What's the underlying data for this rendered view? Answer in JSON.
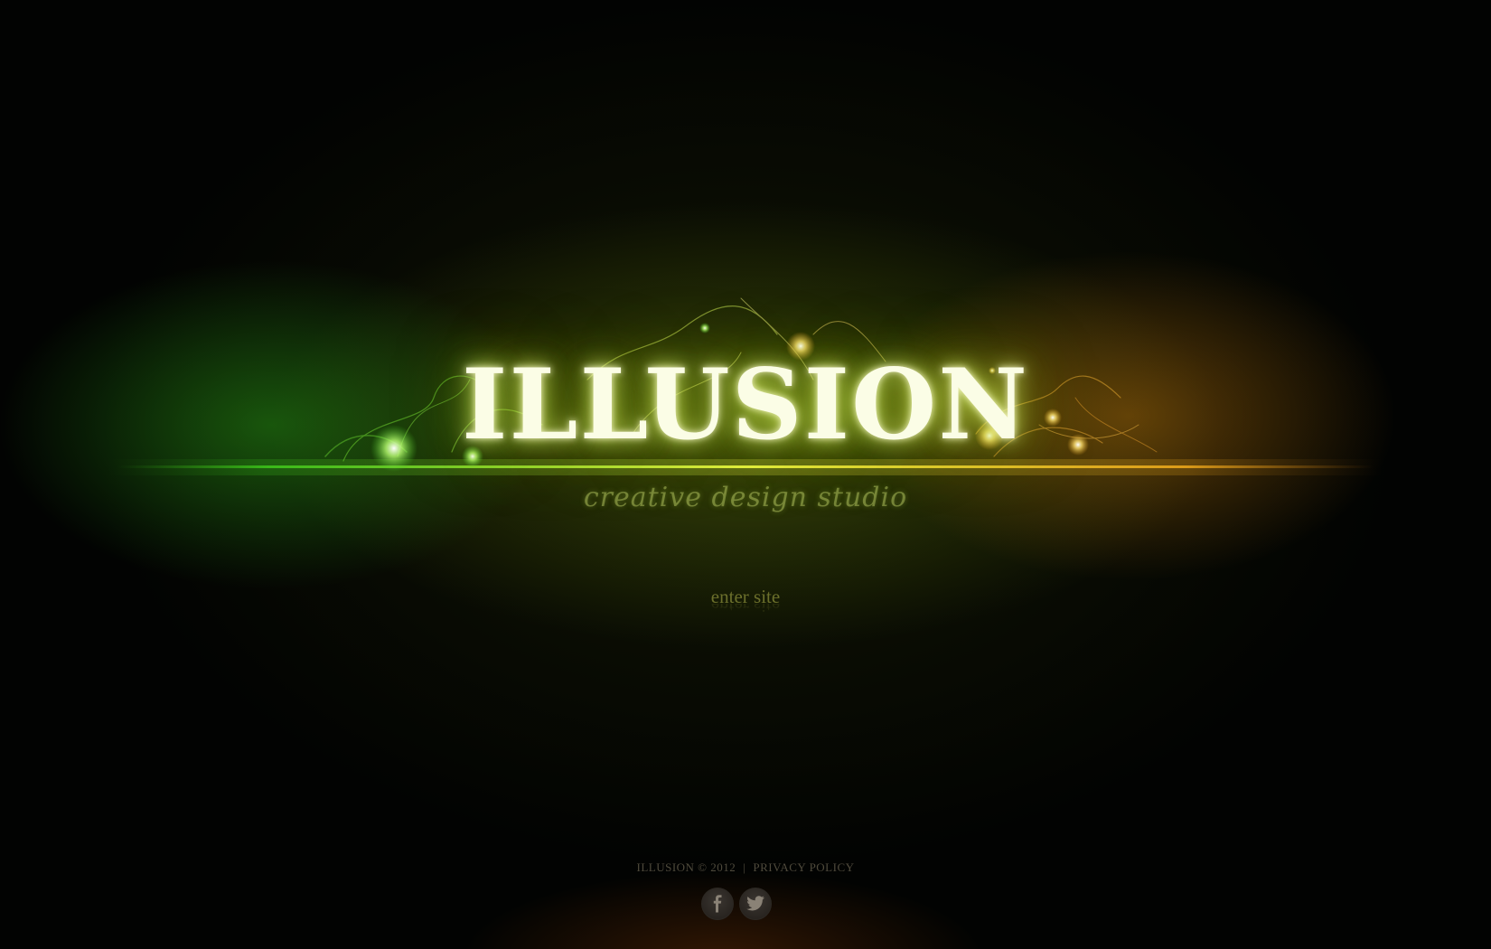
{
  "logo": {
    "title": "ILLUSION",
    "tagline": "creative design studio"
  },
  "main": {
    "enter_label": "enter site"
  },
  "footer": {
    "copyright": "ILLUSION © 2012",
    "separator": "|",
    "privacy_label": "PRIVACY POLICY"
  },
  "social": [
    {
      "icon": "facebook-icon"
    },
    {
      "icon": "twitter-icon"
    }
  ],
  "colors": {
    "logo_text": "#fbfde6",
    "glow_green": "#3cc21a",
    "glow_yellow": "#e6e41a",
    "glow_orange": "#e8a41a",
    "enter_text": "#6b6f2b",
    "footer_text": "#4f4a3c"
  }
}
